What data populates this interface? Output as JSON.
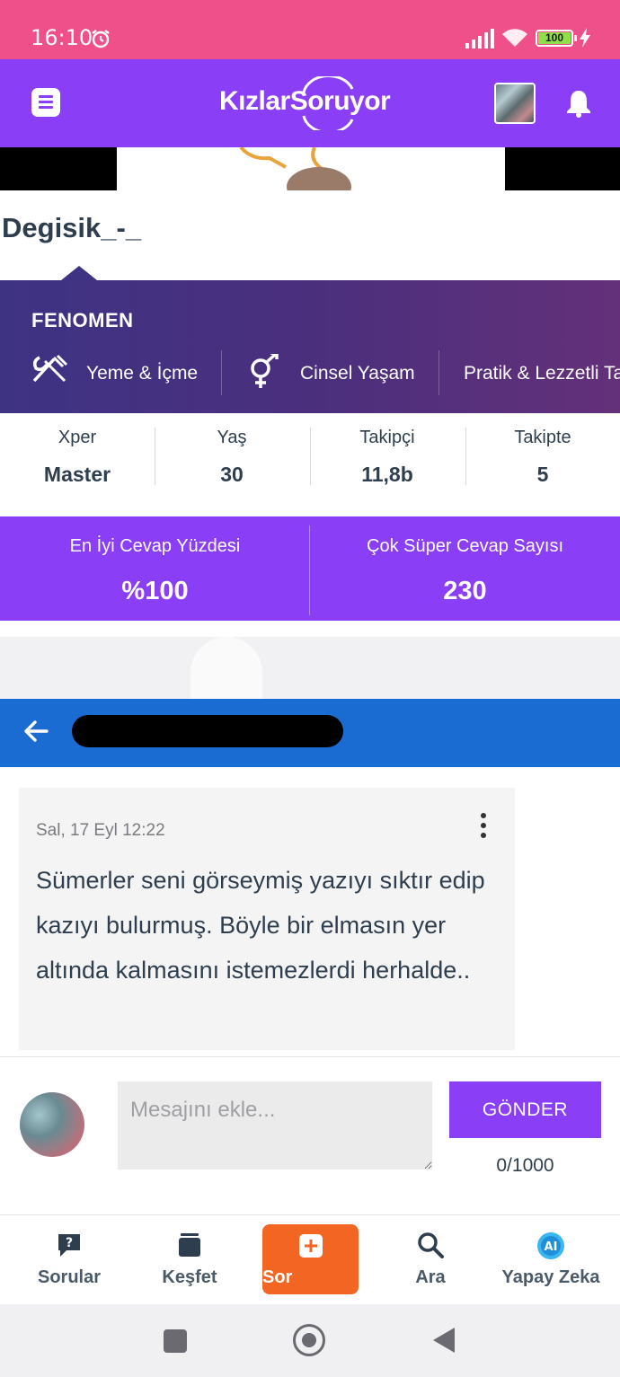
{
  "status_bar": {
    "time": "16:10",
    "battery": "100"
  },
  "header": {
    "logo_text": "KızlarSoruyor"
  },
  "profile": {
    "username": "Degisik_-_"
  },
  "fenomen": {
    "title": "FENOMEN",
    "topics": [
      "Yeme & İçme",
      "Cinsel Yaşam",
      "Pratik & Lezzetli Ta"
    ]
  },
  "stats": [
    {
      "label": "Xper",
      "value": "Master"
    },
    {
      "label": "Yaş",
      "value": "30"
    },
    {
      "label": "Takipçi",
      "value": "11,8b"
    },
    {
      "label": "Takipte",
      "value": "5"
    }
  ],
  "answer_stats": [
    {
      "label": "En İyi Cevap Yüzdesi",
      "value": "%100"
    },
    {
      "label": "Çok Süper Cevap Sayısı",
      "value": "230"
    }
  ],
  "chat": {
    "message_date": "Sal, 17 Eyl 12:22",
    "message_text": "Sümerler seni görseymiş yazıyı sıktır edip kazıyı bulurmuş. Böyle bir elmasın yer altında kalmasını istemezlerdi herhalde.."
  },
  "composer": {
    "placeholder": "Mesajını ekle...",
    "send_label": "GÖNDER",
    "char_count": "0/1000"
  },
  "bottom_nav": [
    {
      "label": "Sorular",
      "icon": "question-bubble-icon"
    },
    {
      "label": "Keşfet",
      "icon": "stack-icon"
    },
    {
      "label": "Sor",
      "icon": "plus-square-icon"
    },
    {
      "label": "Ara",
      "icon": "search-icon"
    },
    {
      "label": "Yapay Zeka",
      "icon": "ai-icon"
    }
  ],
  "colors": {
    "status_bar": "#f0508a",
    "brand_purple": "#8a3ef6",
    "chat_header_blue": "#1a6bd2",
    "ask_orange": "#f26522"
  }
}
